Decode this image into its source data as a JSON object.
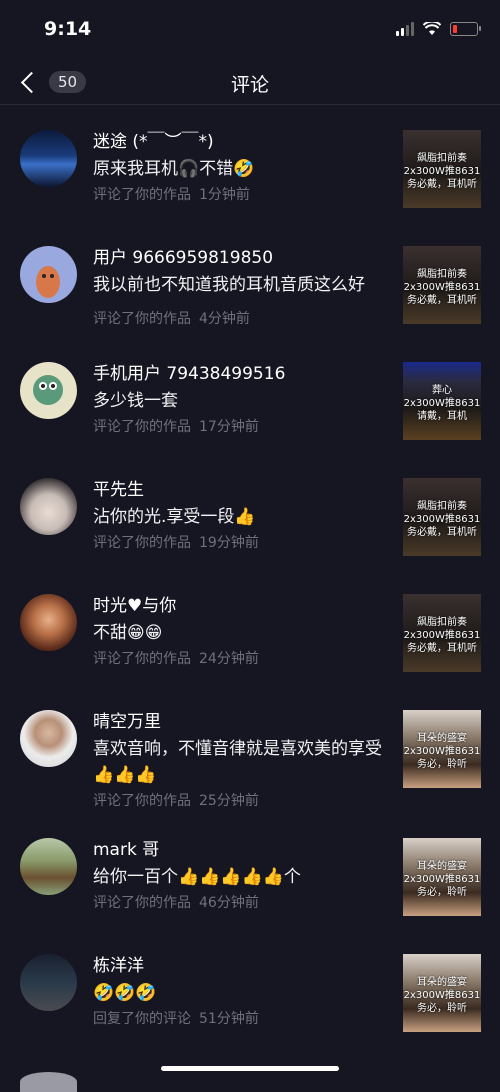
{
  "status_bar": {
    "time": "9:14"
  },
  "nav": {
    "back_count": "50",
    "title": "评论"
  },
  "comments": [
    {
      "user": "迷途 (*￣︶￣*)",
      "text": "原来我耳机🎧不错🤣",
      "action": "评论了你的作品",
      "time": "1分钟前",
      "thumb": [
        "飙脂扣前奏",
        "2x300W推8631",
        "务必戴，耳机听"
      ]
    },
    {
      "user": "用户 9666959819850",
      "text": "我以前也不知道我的耳机音质这么好",
      "action": "评论了你的作品",
      "time": "4分钟前",
      "thumb": [
        "飙脂扣前奏",
        "2x300W推8631",
        "务必戴，耳机听"
      ]
    },
    {
      "user": "手机用户 79438499516",
      "text": "多少钱一套",
      "action": "评论了你的作品",
      "time": "17分钟前",
      "thumb": [
        "葬心",
        "2x300W推8631",
        "请戴，耳机"
      ]
    },
    {
      "user": "平先生",
      "text": "沾你的光.享受一段👍",
      "action": "评论了你的作品",
      "time": "19分钟前",
      "thumb": [
        "飙脂扣前奏",
        "2x300W推8631",
        "务必戴，耳机听"
      ]
    },
    {
      "user": "时光♥与你",
      "text": "不甜😁😁",
      "action": "评论了你的作品",
      "time": "24分钟前",
      "thumb": [
        "飙脂扣前奏",
        "2x300W推8631",
        "务必戴，耳机听"
      ]
    },
    {
      "user": "晴空万里",
      "text": "喜欢音响，不懂音律就是喜欢美的享受👍👍👍",
      "action": "评论了你的作品",
      "time": "25分钟前",
      "thumb": [
        "耳朵的盛宴",
        "2x300W推8631",
        "务必，聆听"
      ]
    },
    {
      "user": "mark 哥",
      "text": "给你一百个👍👍👍👍👍个",
      "action": "评论了你的作品",
      "time": "46分钟前",
      "thumb": [
        "耳朵的盛宴",
        "2x300W推8631",
        "务必，聆听"
      ]
    },
    {
      "user": "栋洋洋",
      "text": "🤣🤣🤣",
      "action": "回复了你的评论",
      "time": "51分钟前",
      "thumb": [
        "耳朵的盛宴",
        "2x300W推8631",
        "务必，聆听"
      ]
    }
  ]
}
